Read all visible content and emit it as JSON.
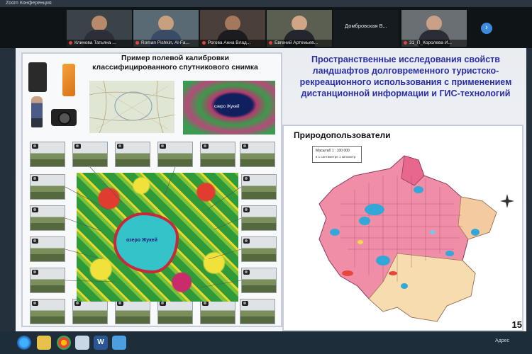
{
  "window": {
    "title": "Zoom Конференция"
  },
  "participants": [
    {
      "name": "Клинова Татьяна ..."
    },
    {
      "name": "Roman Pishkin, Al-Fa..."
    },
    {
      "name": "Рогова Анна Влад..."
    },
    {
      "name": "Евгений Артемьев..."
    },
    {
      "name": "Домбровская  В..."
    },
    {
      "name": "31_П_Королева И..."
    }
  ],
  "slide": {
    "left_title": "Пример полевой калибровки классифицированного спутникового снимка",
    "main_title": "Пространственные исследования свойств ландшафтов долговременного туристско-рекреационного использования с применением дистанционной информации и ГИС-технологий",
    "right_heading": "Природопользователи",
    "lake_label": "озеро Жукей",
    "sat_label": "озеро Жукей",
    "legend_title": "Масштаб 1 : 100 000",
    "legend_sub": "в 1 сантиметре 1 километр",
    "page_number": "15"
  },
  "taskbar": {
    "word_icon": "W",
    "right_text": "Адрес"
  },
  "colors": {
    "title_blue": "#2b2fa7",
    "map_pink": "#f08ea8",
    "lake": "#33c3c8"
  }
}
